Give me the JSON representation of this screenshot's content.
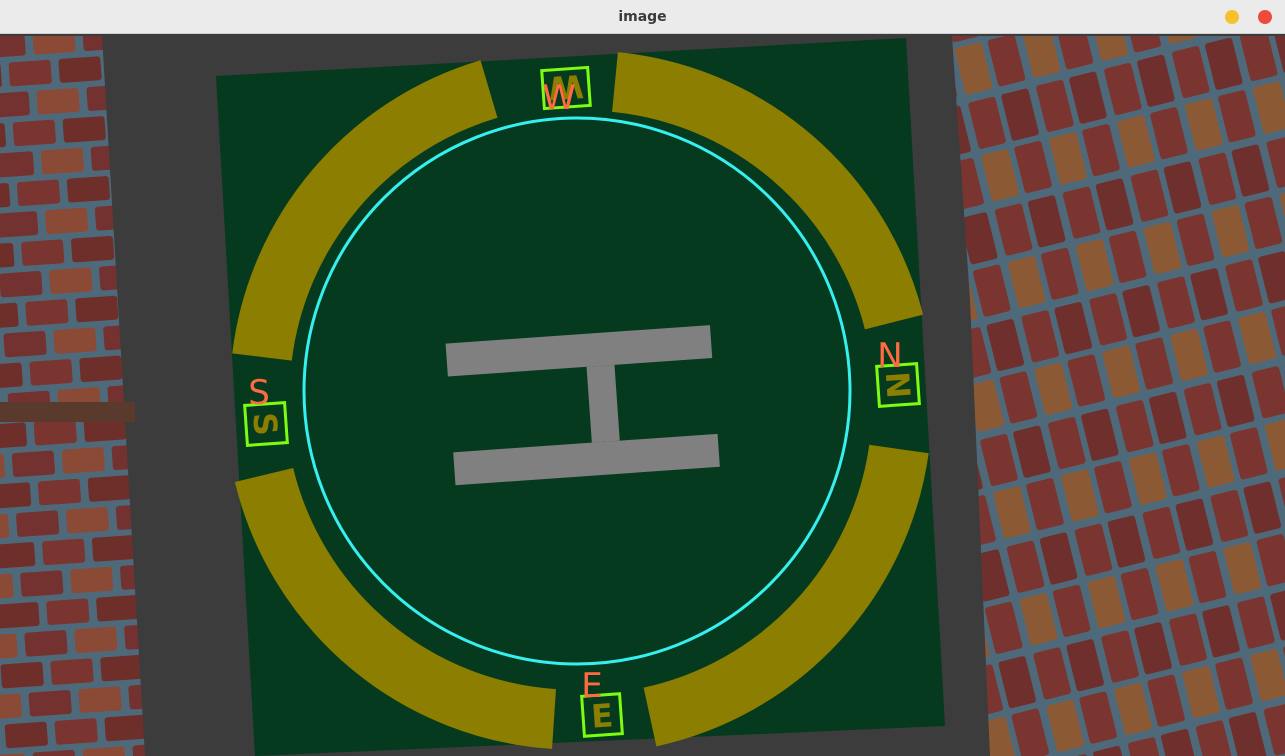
{
  "window": {
    "title": "image",
    "buttons": [
      {
        "name": "minimize",
        "color": "#f6c12d"
      },
      {
        "name": "close",
        "color": "#ef4b3d"
      }
    ]
  },
  "scene": {
    "pad_letter": "H",
    "markers": [
      {
        "label": "W",
        "name": "W"
      },
      {
        "label": "N",
        "name": "N"
      },
      {
        "label": "S",
        "name": "S"
      },
      {
        "label": "E",
        "name": "E"
      }
    ],
    "colors": {
      "background": "#3c3c3c",
      "pad": "#053a1f",
      "ring": "#8b7e00",
      "center_mark": "#808080",
      "detected_circle": "#36f0f0",
      "marker_box": "#7cfc10",
      "marker_label": "#ff6a40",
      "brick": "#7a3530",
      "mortar": "#4e6a7a"
    }
  }
}
